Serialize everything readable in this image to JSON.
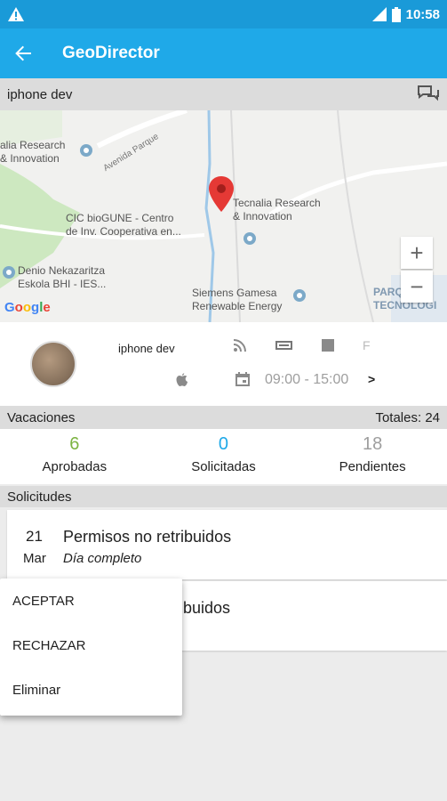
{
  "status": {
    "time": "10:58"
  },
  "appbar": {
    "title": "GeoDirector",
    "back_icon": "arrow-left-icon"
  },
  "subheader": {
    "title": "iphone dev",
    "chat_icon": "chat-bubbles-icon"
  },
  "map": {
    "labels": {
      "tecnalia_left": "alia Research\n& Innovation",
      "tecnalia_right": "Tecnalia Research\n& Innovation",
      "cic": "CIC bioGUNE - Centro\nde Inv. Cooperativa en...",
      "denio": "Denio Nekazaritza\nEskola BHI - IES...",
      "siemens": "Siemens Gamesa\nRenewable Energy",
      "parque": "PARQUE\nTECNOLOGI",
      "road": "Avenida Parque"
    },
    "zoom_in": "+",
    "zoom_out": "−",
    "logo": "Google"
  },
  "profile": {
    "name": "iphone dev",
    "icons": [
      "rss-icon",
      "battery-icon",
      "square-icon"
    ],
    "flag": "F",
    "os_icon": "apple-icon",
    "calendar_icon": "calendar-icon",
    "hours": "09:00 - 15:00",
    "more": ">"
  },
  "vacations": {
    "header": "Vacaciones",
    "total": "Totales: 24",
    "stats": [
      {
        "value": "6",
        "label": "Aprobadas",
        "color": "#7cb342"
      },
      {
        "value": "0",
        "label": "Solicitadas",
        "color": "#1fa9e8"
      },
      {
        "value": "18",
        "label": "Pendientes",
        "color": "#9e9e9e"
      }
    ]
  },
  "requests": {
    "header": "Solicitudes",
    "items": [
      {
        "day": "21",
        "month": "Mar",
        "title": "Permisos no retribuidos",
        "subtitle": "Día completo"
      },
      {
        "day": "",
        "month": "",
        "title": "ribuidos",
        "subtitle": ""
      }
    ]
  },
  "popup_menu": [
    "ACEPTAR",
    "RECHAZAR",
    "Eliminar"
  ]
}
